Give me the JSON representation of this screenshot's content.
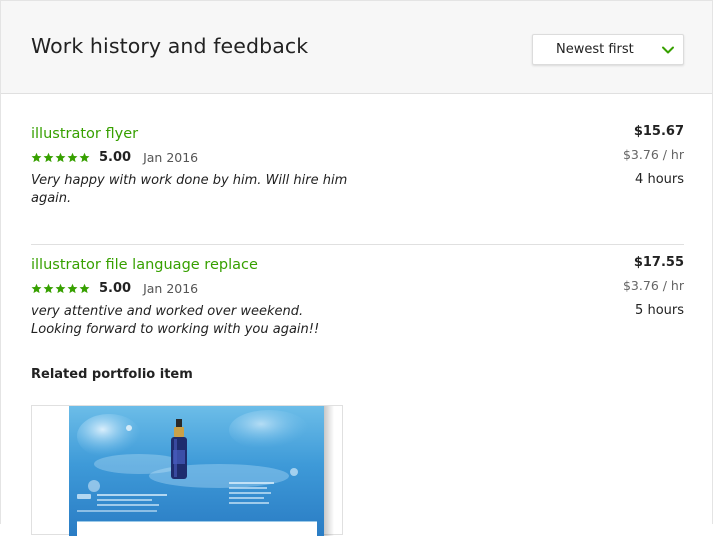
{
  "header": {
    "title": "Work history and feedback",
    "sort": {
      "selected": "Newest first"
    }
  },
  "jobs": [
    {
      "title": "illustrator flyer",
      "rating": "5.00",
      "stars": 5,
      "date": "Jan 2016",
      "feedback": "Very happy with work done by him. Will hire him again.",
      "amount": "$15.67",
      "rate": "$3.76 / hr",
      "hours": "4 hours"
    },
    {
      "title": "illustrator file language replace",
      "rating": "5.00",
      "stars": 5,
      "date": "Jan 2016",
      "feedback": "very attentive and worked over weekend. Looking forward to working with you again!!",
      "amount": "$17.55",
      "rate": "$3.76 / hr",
      "hours": "5 hours"
    }
  ],
  "portfolio": {
    "heading": "Related portfolio item"
  },
  "colors": {
    "accent": "#37a000",
    "star": "#37a000"
  }
}
